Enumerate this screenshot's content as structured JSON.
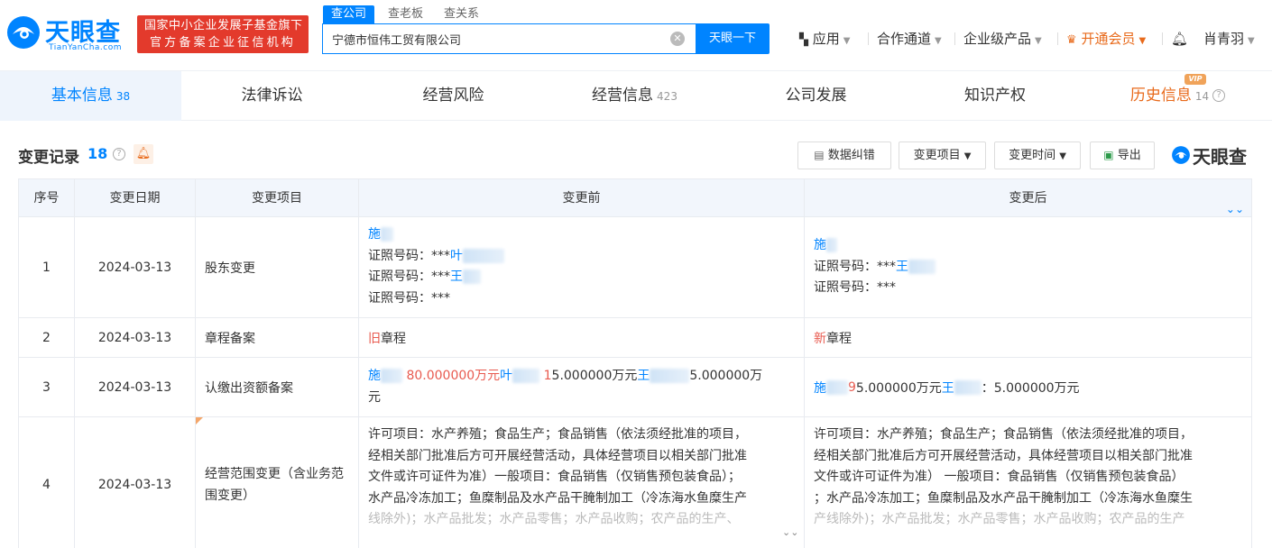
{
  "brand": {
    "name_cn": "天眼查",
    "name_en": "TianYanCha.com",
    "color": "#0084ff"
  },
  "gov_badge": {
    "line1": "国家中小企业发展子基金旗下",
    "line2": "官方备案企业征信机构",
    "color": "#e33a2c"
  },
  "search": {
    "tabs": [
      "查公司",
      "查老板",
      "查关系"
    ],
    "active_tab": "查公司",
    "value": "宁德市恒伟工贸有限公司",
    "button": "天眼一下",
    "clear_icon": "close-circle-icon"
  },
  "topnav": {
    "apps": "应用",
    "cooperation": "合作通道",
    "enterprise": "企业级产品",
    "vip": "开通会员",
    "user": "肖青羽",
    "apps_icon": "grid-icon",
    "vip_icon": "crown-icon",
    "bell_icon": "bell-icon",
    "vip_color": "#e86a1b"
  },
  "tabs": [
    {
      "label": "基本信息",
      "count": "38"
    },
    {
      "label": "法律诉讼",
      "count": ""
    },
    {
      "label": "经营风险",
      "count": ""
    },
    {
      "label": "经营信息",
      "count": "423"
    },
    {
      "label": "公司发展",
      "count": ""
    },
    {
      "label": "知识产权",
      "count": ""
    },
    {
      "label": "历史信息",
      "count": "14",
      "badge": "VIP"
    }
  ],
  "section": {
    "title": "变更记录",
    "count": "18",
    "tools": {
      "correct": "数据纠错",
      "filter_item": "变更项目",
      "filter_time": "变更时间",
      "export": "导出"
    },
    "brand_right": "天眼查"
  },
  "table": {
    "headers": [
      "序号",
      "变更日期",
      "变更项目",
      "变更前",
      "变更后"
    ],
    "rows": [
      {
        "idx": "1",
        "date": "2024-03-13",
        "item": "股东变更",
        "before": {
          "name": "施",
          "cert_label": "证照号码：",
          "cert_1": "***",
          "name_1": "叶",
          "cert_2": "***",
          "name_2": "王",
          "cert_3": "***"
        },
        "after": {
          "name": "施",
          "cert_label": "证照号码：",
          "cert_1": "***",
          "name_1": "王",
          "cert_2": "***"
        }
      },
      {
        "idx": "2",
        "date": "2024-03-13",
        "item": "章程备案",
        "before": {
          "mark": "旧",
          "text": "章程"
        },
        "after": {
          "mark": "新",
          "text": "章程"
        }
      },
      {
        "idx": "3",
        "date": "2024-03-13",
        "item": "认缴出资额备案",
        "before": {
          "name_a": "施",
          "amount_a": "80.000000万元",
          "name_b": "叶",
          "amount_b_lead": "1",
          "amount_b": "5.000000万元",
          "name_c": "王",
          "amount_c": "5.000000万",
          "tail": "元"
        },
        "after": {
          "name_a": "施",
          "amount_a_lead": "9",
          "amount_a": "5.000000万元",
          "name_b": "王",
          "amount_b": "：5.000000万元"
        }
      },
      {
        "idx": "4",
        "date": "2024-03-13",
        "item": "经营范围变更（含业务范围变更）",
        "before": {
          "l1": "许可项目：水产养殖；食品生产；食品销售（依法须经批准的项目，",
          "l2": "经相关部门批准后方可开展经营活动，具体经营项目以相关部门批准",
          "l3": "文件或许可证件为准）一般项目：食品销售（仅销售预包装食品）；",
          "l4": "水产品冷冻加工；鱼糜制品及水产品干腌制加工（冷冻海水鱼糜生产",
          "l5": "线除外)；水产品批发；水产品零售；水产品收购；农产品的生产、"
        },
        "after": {
          "l1": "许可项目：水产养殖；食品生产；食品销售（依法须经批准的项目，",
          "l2": "经相关部门批准后方可开展经营活动，具体经营项目以相关部门批准",
          "l3": "文件或许可证件为准） 一般项目：食品销售（仅销售预包装食品）",
          "l4": "；水产品冷冻加工；鱼糜制品及水产品干腌制加工（冷冻海水鱼糜生",
          "l5": "产线除外)；水产品批发；水产品零售；水产品收购；农产品的生产"
        }
      }
    ]
  }
}
